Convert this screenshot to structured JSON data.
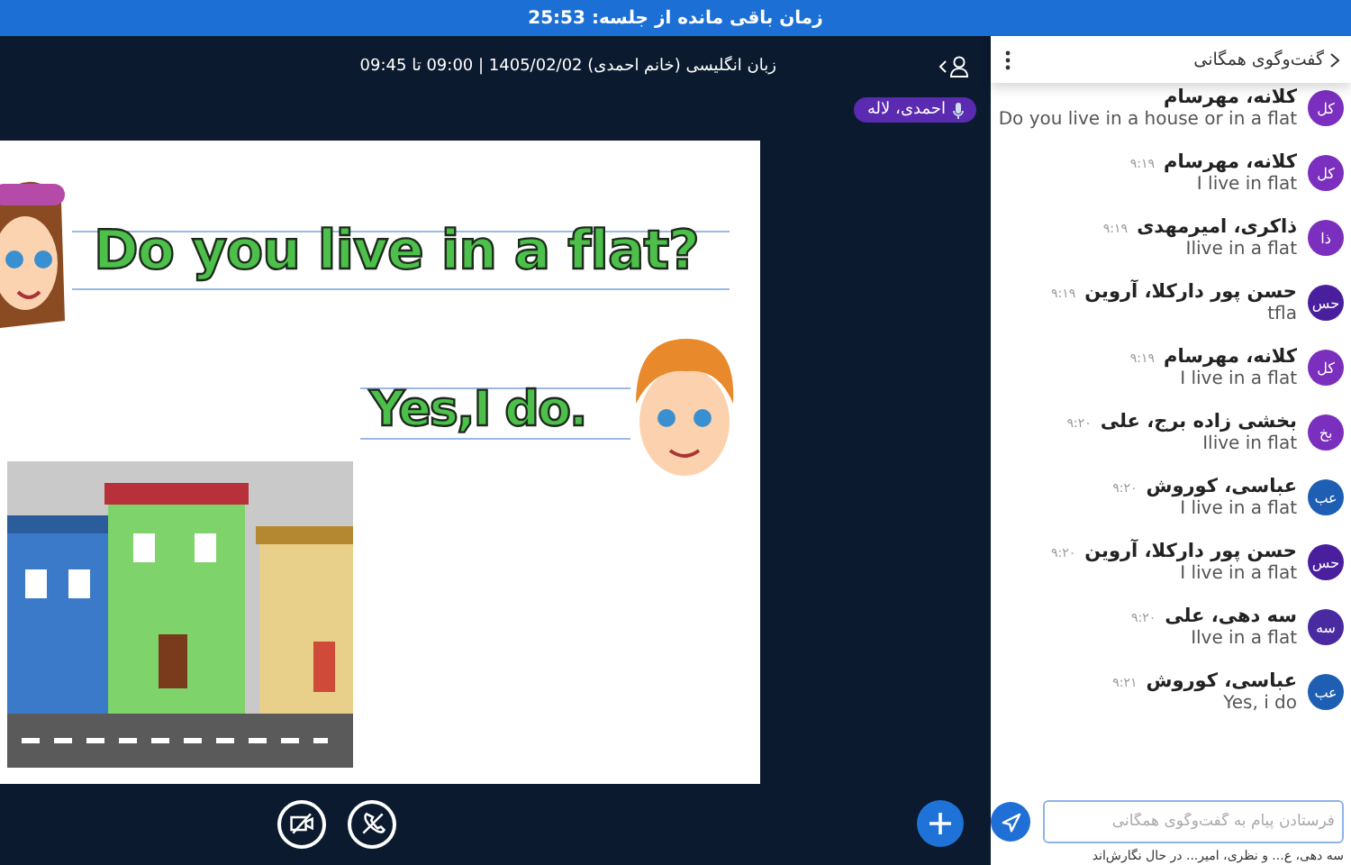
{
  "banner": {
    "text": "زمان باقی مانده از جلسه: 25:53"
  },
  "session": {
    "title": "زبان انگلیسی (خانم احمدی) 1405/02/02 | 09:00 تا 09:45",
    "speaker": "احمدی، لاله"
  },
  "slide": {
    "question": "Do you live in a flat?",
    "answer": "Yes,I do."
  },
  "controls": [
    {
      "kind": "video-off"
    },
    {
      "kind": "phone-off"
    }
  ],
  "chat": {
    "title": "گفت‌وگوی همگانی",
    "messages": [
      {
        "initials": "کل",
        "color": "#7b2fbe",
        "name": "کلانه، مهرسام",
        "text": "Do you live in a house or in a flat"
      },
      {
        "initials": "کل",
        "color": "#7b2fbe",
        "name": "کلانه، مهرسام",
        "time": "۹:۱۹",
        "text": "I live in flat"
      },
      {
        "initials": "ذا",
        "color": "#7b2fbe",
        "name": "ذاکری، امیرمهدی",
        "time": "۹:۱۹",
        "text": "Ilive in a flat"
      },
      {
        "initials": "حس",
        "color": "#4a1f9e",
        "name": "حسن پور دارکلا، آروین",
        "time": "۹:۱۹",
        "text": "tfla"
      },
      {
        "initials": "کل",
        "color": "#7b2fbe",
        "name": "کلانه، مهرسام",
        "time": "۹:۱۹",
        "text": "I live in a flat"
      },
      {
        "initials": "بخ",
        "color": "#7b2fbe",
        "name": "بخشی زاده برج، علی",
        "time": "۹:۲۰",
        "text": "Ilive in flat"
      },
      {
        "initials": "عب",
        "color": "#1e5fb4",
        "name": "عباسی، کوروش",
        "time": "۹:۲۰",
        "text": "I live in a flat"
      },
      {
        "initials": "حس",
        "color": "#4a1f9e",
        "name": "حسن پور دارکلا، آروین",
        "time": "۹:۲۰",
        "text": "I live in a flat"
      },
      {
        "initials": "سه",
        "color": "#4a2aa0",
        "name": "سه دهی، علی",
        "time": "۹:۲۰",
        "text": "Ilve in a flat"
      },
      {
        "initials": "عب",
        "color": "#1e5fb4",
        "name": "عباسی، کوروش",
        "time": "۹:۲۱",
        "text": "Yes, i do"
      }
    ],
    "placeholder": "فرستادن پیام به گفت‌وگوی همگانی",
    "typing": "سه دهی، ع... و نظری، امیر... در حال نگارش‌اند"
  }
}
